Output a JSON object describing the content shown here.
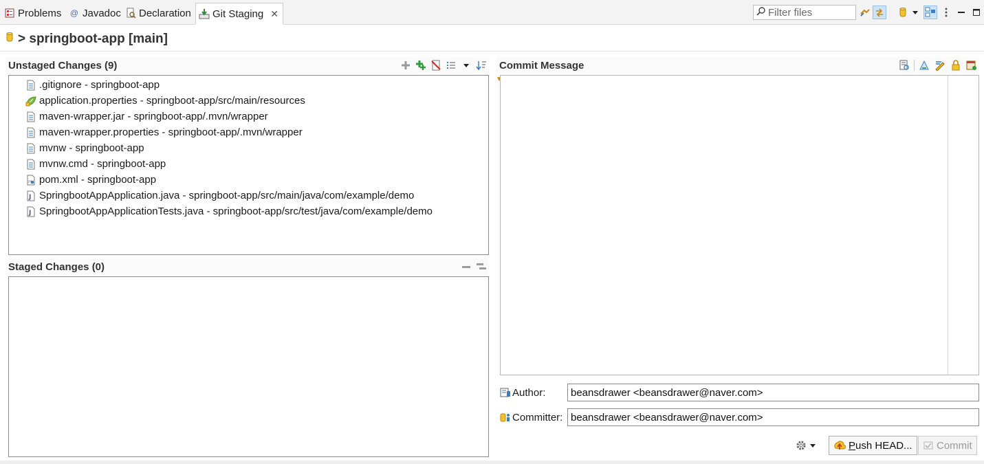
{
  "tabs": [
    {
      "label": "Problems",
      "icon": "problems-icon"
    },
    {
      "label": "Javadoc",
      "icon": "javadoc-icon"
    },
    {
      "label": "Declaration",
      "icon": "declaration-icon"
    },
    {
      "label": "Git Staging",
      "icon": "git-staging-icon",
      "active": true,
      "close": "✕"
    }
  ],
  "filter": {
    "placeholder": "Filter files"
  },
  "repo": {
    "title": "> springboot-app [main]"
  },
  "unstaged": {
    "header": "Unstaged Changes (9)",
    "files": [
      {
        "label": ".gitignore - springboot-app",
        "icon": "text-file-icon"
      },
      {
        "label": "application.properties - springboot-app/src/main/resources",
        "icon": "spring-properties-icon"
      },
      {
        "label": "maven-wrapper.jar - springboot-app/.mvn/wrapper",
        "icon": "text-file-icon"
      },
      {
        "label": "maven-wrapper.properties - springboot-app/.mvn/wrapper",
        "icon": "text-file-icon"
      },
      {
        "label": "mvnw - springboot-app",
        "icon": "text-file-icon"
      },
      {
        "label": "mvnw.cmd - springboot-app",
        "icon": "text-file-icon"
      },
      {
        "label": "pom.xml - springboot-app",
        "icon": "xml-file-icon"
      },
      {
        "label": "SpringbootAppApplication.java - springboot-app/src/main/java/com/example/demo",
        "icon": "java-file-icon"
      },
      {
        "label": "SpringbootAppApplicationTests.java - springboot-app/src/test/java/com/example/demo",
        "icon": "java-file-icon"
      }
    ]
  },
  "staged": {
    "header": "Staged Changes (0)",
    "files": []
  },
  "commit": {
    "header": "Commit Message",
    "message": "",
    "author_label": "Author:",
    "author_value": "beansdrawer <beansdrawer@naver.com>",
    "committer_label": "Committer:",
    "committer_value": "beansdrawer <beansdrawer@naver.com>",
    "push_label_u": "P",
    "push_label_rest": "ush HEAD...",
    "commit_label": "Commit"
  },
  "colors": {
    "accent": "#3d7fc4",
    "selection": "#cfe3f6",
    "border": "#8a8a8a"
  }
}
